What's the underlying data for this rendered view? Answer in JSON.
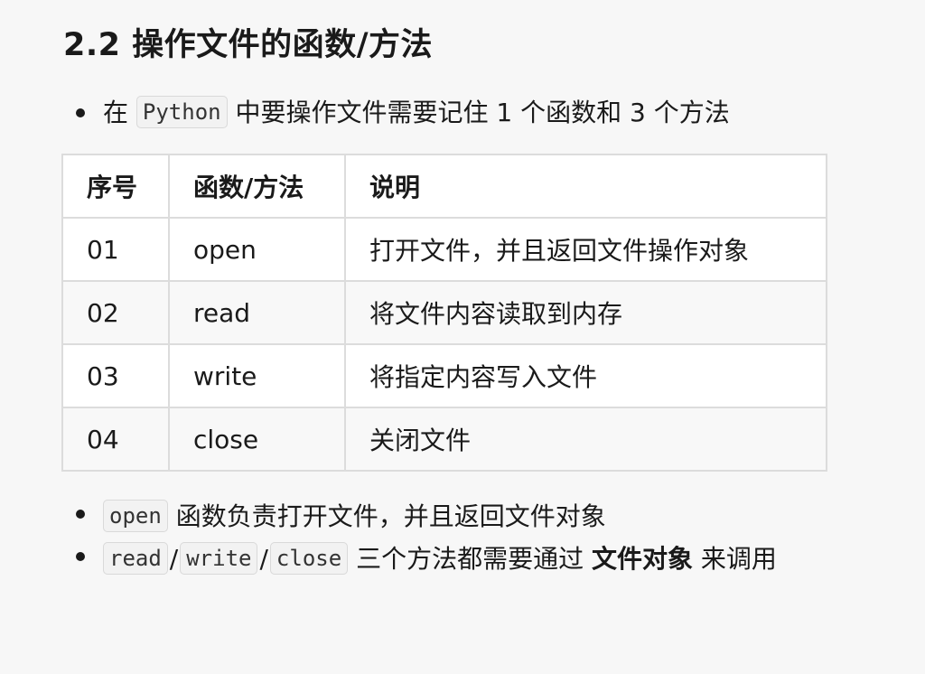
{
  "heading": "2.2 操作文件的函数/方法",
  "intro": {
    "before": "在 ",
    "code": "Python",
    "after": " 中要操作文件需要记住 1 个函数和 3 个方法"
  },
  "table": {
    "headers": [
      "序号",
      "函数/方法",
      "说明"
    ],
    "rows": [
      [
        "01",
        "open",
        "打开文件，并且返回文件操作对象"
      ],
      [
        "02",
        "read",
        "将文件内容读取到内存"
      ],
      [
        "03",
        "write",
        "将指定内容写入文件"
      ],
      [
        "04",
        "close",
        "关闭文件"
      ]
    ]
  },
  "notes": {
    "open_code": "open",
    "open_text": " 函数负责打开文件，并且返回文件对象",
    "read_code": "read",
    "write_code": "write",
    "close_code": "close",
    "slash": "/",
    "methods_text": " 三个方法都需要通过 ",
    "methods_strong": "文件对象",
    "methods_end": " 来调用"
  }
}
